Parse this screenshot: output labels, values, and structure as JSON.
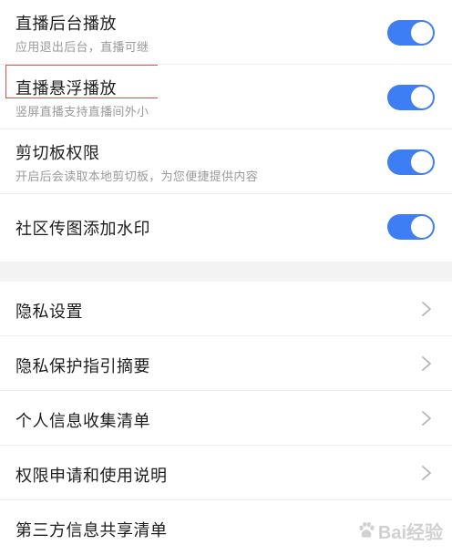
{
  "toggles": [
    {
      "title": "直播后台播放",
      "subtitle": "应用退出后台，直播可继",
      "enabled": true
    },
    {
      "title": "直播悬浮播放",
      "subtitle": "竖屏直播支持直播间外小",
      "enabled": true
    },
    {
      "title": "剪切板权限",
      "subtitle": "开启后会读取本地剪切板，为您便捷提供内容",
      "enabled": true
    },
    {
      "title": "社区传图添加水印",
      "subtitle": "",
      "enabled": true
    }
  ],
  "links": [
    {
      "title": "隐私设置"
    },
    {
      "title": "隐私保护指引摘要"
    },
    {
      "title": "个人信息收集清单"
    },
    {
      "title": "权限申请和使用说明"
    },
    {
      "title": "第三方信息共享清单"
    }
  ],
  "watermark": {
    "text": "Bai经验"
  },
  "colors": {
    "toggle_on": "#3d7ef5",
    "highlight": "#d9534f",
    "section_gap": "#f3f3f3"
  }
}
